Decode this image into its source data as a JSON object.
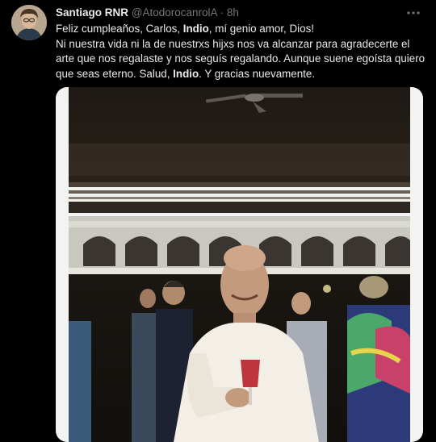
{
  "tweet": {
    "author_name": "Santiago RNR",
    "handle": "@AtodorocanrolA",
    "separator": "·",
    "time": "8h",
    "text": {
      "l1_a": "Feliz cumpleaños, Carlos, ",
      "l1_b": "Indio",
      "l1_c": ", mí genio amor, Dios!",
      "l2": "Ni nuestra vida ni la de nuestrxs hijxs nos va alcanzar para agradecerte el arte que nos regalaste y nos seguís regalando. Aunque suene egoísta quiero que seas eterno. Salud, ",
      "l2_b": "Indio",
      "l2_c": ". Y gracias nuevamente."
    }
  },
  "icons": {
    "more": "more-horizontal-icon"
  },
  "colors": {
    "background": "#000000",
    "text": "#e7e9ea",
    "secondary": "#71767b"
  }
}
